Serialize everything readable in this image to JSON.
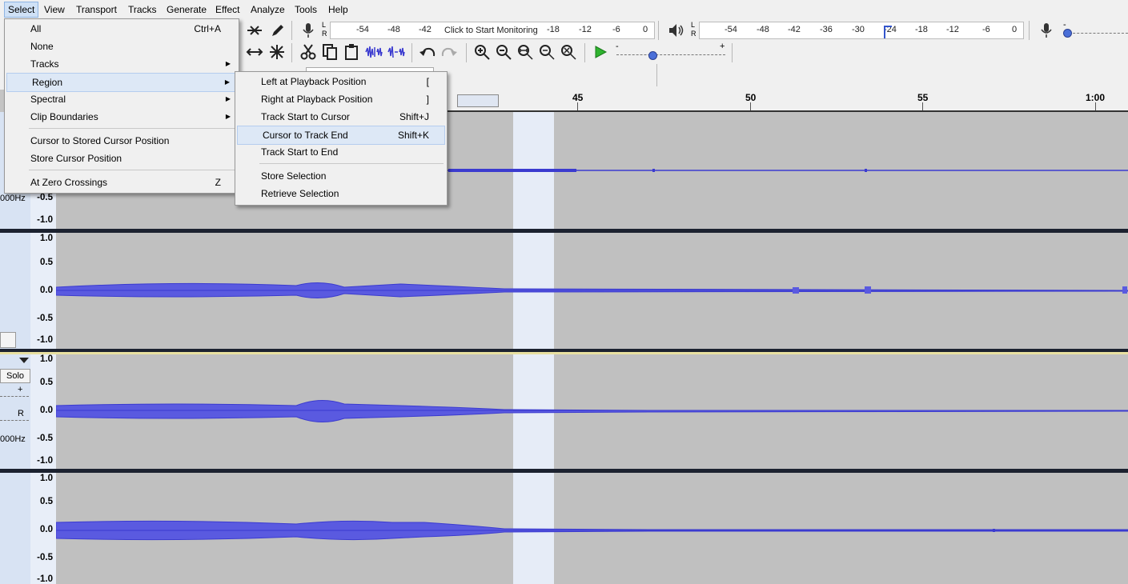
{
  "menubar": [
    "Select",
    "View",
    "Transport",
    "Tracks",
    "Generate",
    "Effect",
    "Analyze",
    "Tools",
    "Help"
  ],
  "meters": {
    "play_ticks": [
      "-54",
      "-48",
      "-42",
      "Click to Start Monitoring",
      "-18",
      "-12",
      "-6",
      "0"
    ],
    "rec_ticks": [
      "-54",
      "-48",
      "-42",
      "-36",
      "-30",
      "-24",
      "-18",
      "-12",
      "-6",
      "0"
    ],
    "lr_l": "L",
    "lr_r": "R",
    "slider_minus": "-",
    "slider_plus": "+"
  },
  "ruler": {
    "labels": [
      "45",
      "50",
      "55",
      "1:00"
    ]
  },
  "track_ctl": {
    "hz1": "000Hz",
    "solo": "Solo",
    "plus": "+",
    "r": "R",
    "hz2": "000Hz"
  },
  "scale": [
    "1.0",
    "0.5",
    "0.0",
    "-0.5",
    "-1.0"
  ],
  "select_menu": {
    "items": [
      {
        "label": "All",
        "shortcut": "Ctrl+A"
      },
      {
        "label": "None",
        "shortcut": ""
      },
      {
        "label": "Tracks",
        "shortcut": ""
      },
      {
        "label": "Region",
        "shortcut": ""
      },
      {
        "label": "Spectral",
        "shortcut": ""
      },
      {
        "label": "Clip Boundaries",
        "shortcut": ""
      },
      {
        "label": "Cursor to Stored Cursor Position",
        "shortcut": ""
      },
      {
        "label": "Store Cursor Position",
        "shortcut": ""
      },
      {
        "label": "At Zero Crossings",
        "shortcut": "Z"
      }
    ]
  },
  "region_menu": {
    "items": [
      {
        "label": "Left at Playback Position",
        "shortcut": "["
      },
      {
        "label": "Right at Playback Position",
        "shortcut": "]"
      },
      {
        "label": "Track Start to Cursor",
        "shortcut": "Shift+J"
      },
      {
        "label": "Cursor to Track End",
        "shortcut": "Shift+K"
      },
      {
        "label": "Track Start to End",
        "shortcut": ""
      },
      {
        "label": "Store Selection",
        "shortcut": ""
      },
      {
        "label": "Retrieve Selection",
        "shortcut": ""
      }
    ]
  },
  "colors": {
    "wave": "#3b3bcf",
    "selection": "#e6ecf7",
    "menu_highlight": "#dde8f6"
  }
}
